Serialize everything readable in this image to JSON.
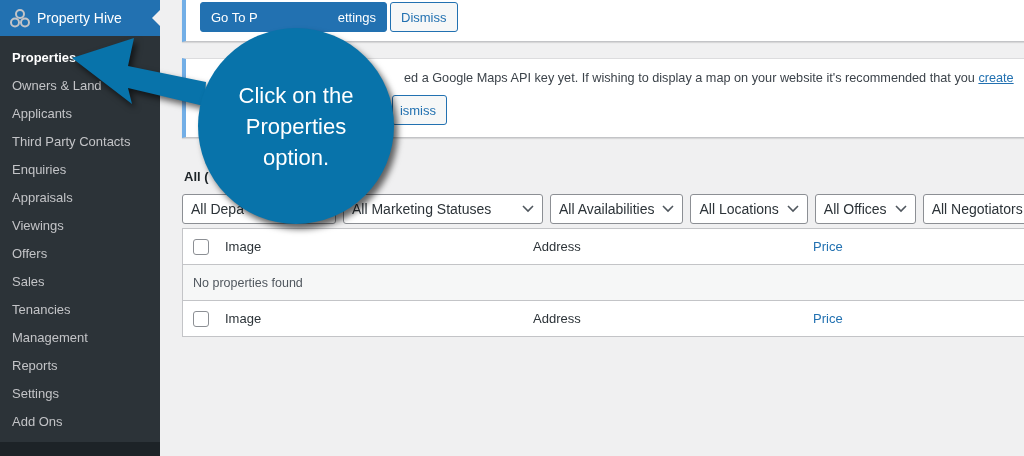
{
  "sidebar": {
    "header": {
      "title": "Property Hive",
      "selected": true
    },
    "items": [
      {
        "label": "Properties",
        "selected": true
      },
      {
        "label": "Owners & Land",
        "selected": false
      },
      {
        "label": "Applicants",
        "selected": false
      },
      {
        "label": "Third Party Contacts",
        "selected": false
      },
      {
        "label": "Enquiries",
        "selected": false
      },
      {
        "label": "Appraisals",
        "selected": false
      },
      {
        "label": "Viewings",
        "selected": false
      },
      {
        "label": "Offers",
        "selected": false
      },
      {
        "label": "Sales",
        "selected": false
      },
      {
        "label": "Tenancies",
        "selected": false
      },
      {
        "label": "Management",
        "selected": false
      },
      {
        "label": "Reports",
        "selected": false
      },
      {
        "label": "Settings",
        "selected": false
      },
      {
        "label": "Add Ons",
        "selected": false
      }
    ]
  },
  "notices": [
    {
      "buttons": [
        {
          "kind": "primary",
          "label_start": "Go To P",
          "label_end": "ettings"
        },
        {
          "kind": "secondary",
          "label_start": "Dismiss"
        }
      ]
    },
    {
      "text": "ed a Google Maps API key yet. If wishing to display a map on your website it's recommended that you ",
      "link": "create",
      "buttons": [
        {
          "kind": "secondary",
          "label_end": "ismiss"
        }
      ]
    }
  ],
  "view_links": "All (",
  "filters": [
    "All Depa",
    "All Marketing Statuses",
    "All Availabilities",
    "All Locations",
    "All Offices",
    "All Negotiators"
  ],
  "table": {
    "columns": [
      {
        "label": "Image",
        "sortable": false
      },
      {
        "label": "Address",
        "sortable": false
      },
      {
        "label": "Price",
        "sortable": true
      }
    ],
    "select_all_checked": false,
    "empty_message": "No properties found",
    "footer_columns": [
      {
        "label": "Image",
        "sortable": false
      },
      {
        "label": "Address",
        "sortable": false
      },
      {
        "label": "Price",
        "sortable": true
      }
    ],
    "footer_select_all_checked": false
  },
  "callout": {
    "text": "Click on the Properties option."
  }
}
